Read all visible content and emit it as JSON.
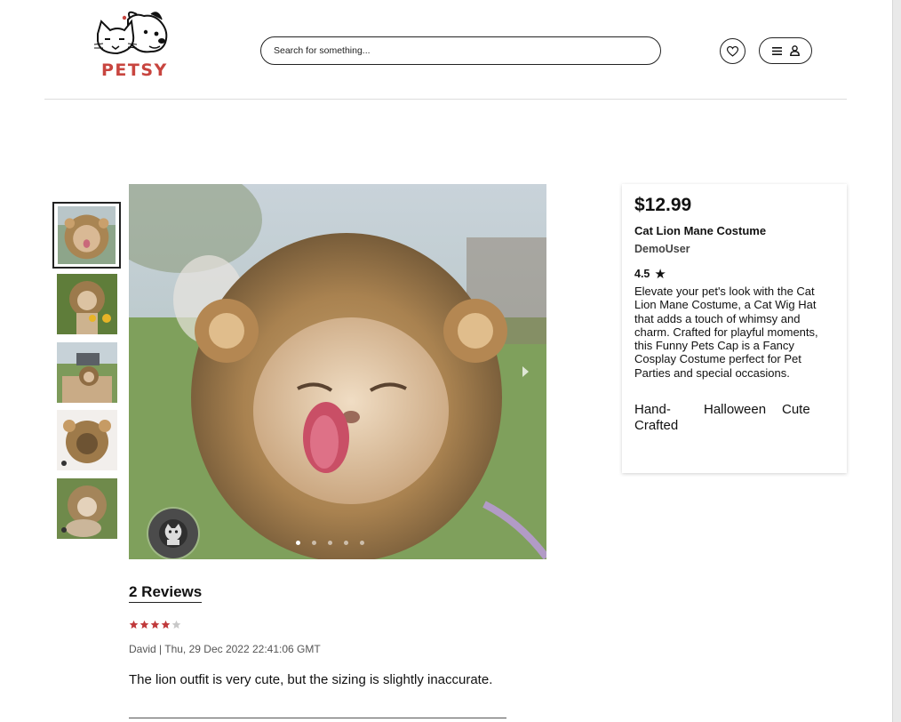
{
  "header": {
    "logo_text": "PETSY",
    "search_placeholder": "Search for something..."
  },
  "product": {
    "price": "$12.99",
    "title": "Cat Lion Mane Costume",
    "seller": "DemoUser",
    "rating": "4.5",
    "rating_icon": "★",
    "description": "Elevate your pet's look with the Cat Lion Mane Costume, a Cat Wig Hat that adds a touch of whimsy and charm. Crafted for playful moments, this Funny Pets Cap is a Fancy Cosplay Costume perfect for Pet Parties and special occasions.",
    "tags": [
      "Hand-Crafted",
      "Halloween",
      "Cute"
    ]
  },
  "gallery": {
    "thumbnail_count": 5,
    "selected_index": 0,
    "dot_count": 5,
    "active_dot": 0
  },
  "reviews": {
    "heading": "2 Reviews",
    "items": [
      {
        "stars": 4,
        "max_stars": 5,
        "author_date": "David | Thu, 29 Dec 2022 22:41:06 GMT",
        "text": "The lion outfit is very cute, but the sizing is slightly inaccurate."
      }
    ]
  },
  "colors": {
    "brand": "#c8453f",
    "star_filled": "#c0393b",
    "star_empty": "#c8c8c8"
  }
}
